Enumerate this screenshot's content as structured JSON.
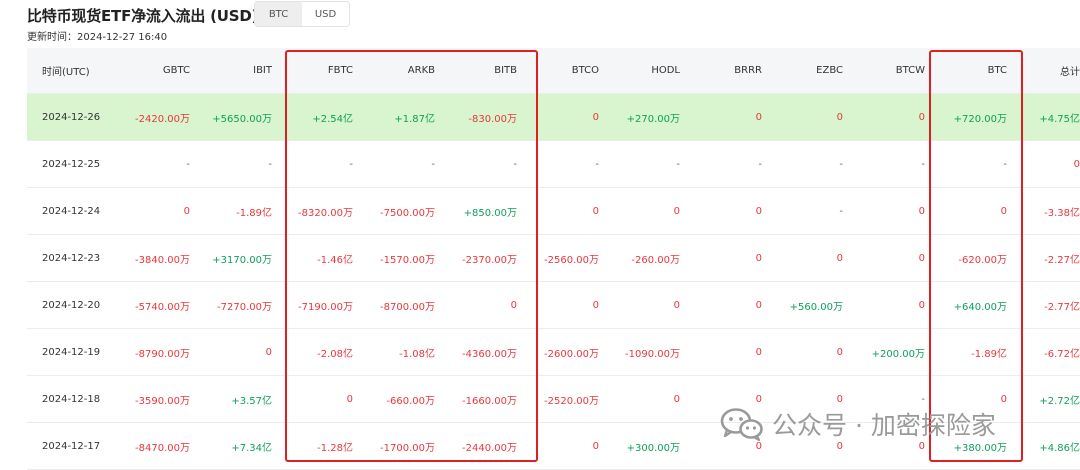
{
  "header": {
    "title": "比特币现货ETF净流入流出 (USD)",
    "updated": "更新时间：2024-12-27 16:40",
    "toggle": [
      {
        "label": "BTC",
        "active": true
      },
      {
        "label": "USD",
        "active": false
      }
    ]
  },
  "table": {
    "columns": [
      "时间(UTC)",
      "GBTC",
      "IBIT",
      "FBTC",
      "ARKB",
      "BITB",
      "BTCO",
      "HODL",
      "BRRR",
      "EZBC",
      "BTCW",
      "BTC",
      "总计"
    ],
    "rows": [
      {
        "date": "2024-12-26",
        "cells": [
          "-2420.00万",
          "+5650.00万",
          "+2.54亿",
          "+1.87亿",
          "-830.00万",
          "0",
          "+270.00万",
          "0",
          "0",
          "0",
          "+720.00万",
          "+4.75亿"
        ]
      },
      {
        "date": "2024-12-25",
        "cells": [
          "-",
          "-",
          "-",
          "-",
          "-",
          "-",
          "-",
          "-",
          "-",
          "-",
          "-",
          "0"
        ]
      },
      {
        "date": "2024-12-24",
        "cells": [
          "0",
          "-1.89亿",
          "-8320.00万",
          "-7500.00万",
          "+850.00万",
          "0",
          "0",
          "0",
          "-",
          "0",
          "0",
          "-3.38亿"
        ]
      },
      {
        "date": "2024-12-23",
        "cells": [
          "-3840.00万",
          "+3170.00万",
          "-1.46亿",
          "-1570.00万",
          "-2370.00万",
          "-2560.00万",
          "-260.00万",
          "0",
          "0",
          "0",
          "-620.00万",
          "-2.27亿"
        ]
      },
      {
        "date": "2024-12-20",
        "cells": [
          "-5740.00万",
          "-7270.00万",
          "-7190.00万",
          "-8700.00万",
          "0",
          "0",
          "0",
          "0",
          "+560.00万",
          "0",
          "+640.00万",
          "-2.77亿"
        ]
      },
      {
        "date": "2024-12-19",
        "cells": [
          "-8790.00万",
          "0",
          "-2.08亿",
          "-1.08亿",
          "-4360.00万",
          "-2600.00万",
          "-1090.00万",
          "0",
          "0",
          "+200.00万",
          "-1.89亿",
          "-6.72亿"
        ]
      },
      {
        "date": "2024-12-18",
        "cells": [
          "-3590.00万",
          "+3.57亿",
          "0",
          "-660.00万",
          "-1660.00万",
          "-2520.00万",
          "0",
          "0",
          "0",
          "-",
          "0",
          "+2.72亿"
        ]
      },
      {
        "date": "2024-12-17",
        "cells": [
          "-8470.00万",
          "+7.34亿",
          "-1.28亿",
          "-1700.00万",
          "-2440.00万",
          "0",
          "+300.00万",
          "0",
          "0",
          "0",
          "+380.00万",
          "+4.86亿"
        ]
      }
    ]
  },
  "watermark": {
    "text": "公众号 · 加密探险家",
    "icon": "wechat-icon"
  }
}
